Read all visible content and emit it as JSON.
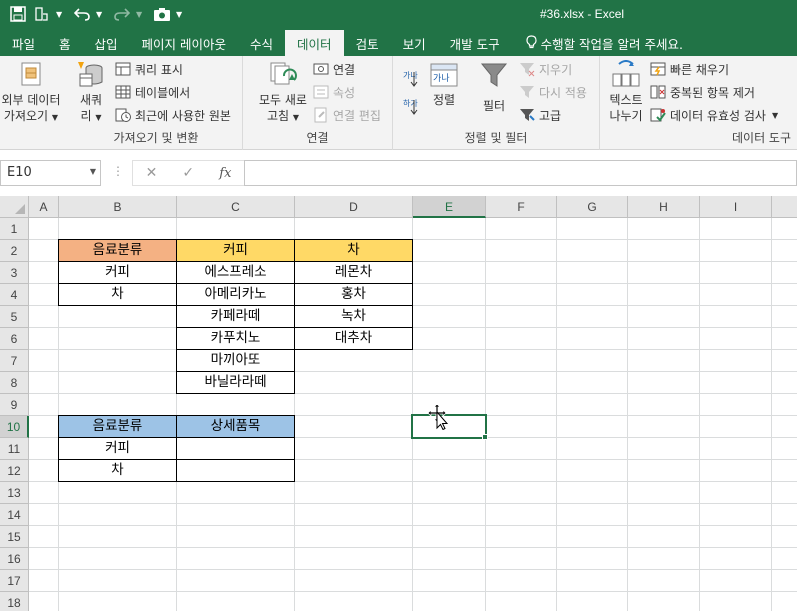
{
  "title": "#36.xlsx - Excel",
  "qat": {
    "save_icon": "save-icon",
    "undo_icon": "undo-icon",
    "redo_icon": "redo-icon",
    "camera_icon": "camera-icon"
  },
  "tabs": [
    {
      "label": "파일"
    },
    {
      "label": "홈"
    },
    {
      "label": "삽입"
    },
    {
      "label": "페이지 레이아웃"
    },
    {
      "label": "수식"
    },
    {
      "label": "데이터",
      "active": true
    },
    {
      "label": "검토"
    },
    {
      "label": "보기"
    },
    {
      "label": "개발 도구"
    },
    {
      "label": "수행할 작업을 알려 주세요."
    }
  ],
  "ribbon": {
    "get_transform": {
      "external_line1": "외부 데이터",
      "external_line2": "가져오기",
      "new_query_line1": "새쿼",
      "new_query_line2": "리",
      "show_queries": "쿼리 표시",
      "from_table": "테이블에서",
      "recent_sources": "최근에 사용한 원본",
      "label": "가져오기 및 변환"
    },
    "connections": {
      "refresh_line1": "모두 새로",
      "refresh_line2": "고침",
      "connections": "연결",
      "properties": "속성",
      "edit_links": "연결 편집",
      "label": "연결"
    },
    "sort_filter": {
      "sort": "정렬",
      "filter": "필터",
      "clear": "지우기",
      "reapply": "다시 적용",
      "advanced": "고급",
      "label": "정렬 및 필터",
      "sort_icon_text": "가나",
      "sort_icon_text2": "하가"
    },
    "data_tools": {
      "text_to_columns_line1": "텍스트",
      "text_to_columns_line2": "나누기",
      "flash_fill": "빠른 채우기",
      "remove_duplicates": "중복된 항목 제거",
      "data_validation": "데이터 유효성 검사",
      "label": "데이터 도구"
    }
  },
  "formula_bar": {
    "name_box": "E10",
    "cancel": "✕",
    "enter": "✓",
    "fx": "fx",
    "value": ""
  },
  "columns": [
    "A",
    "B",
    "C",
    "D",
    "E",
    "F",
    "G",
    "H",
    "I"
  ],
  "rows": [
    "1",
    "2",
    "3",
    "4",
    "5",
    "6",
    "7",
    "8",
    "9",
    "10",
    "11",
    "12",
    "13",
    "14",
    "15",
    "16",
    "17",
    "18"
  ],
  "selected_column": "E",
  "selected_row": "10",
  "table1": {
    "headers": [
      "음료분류",
      "커피",
      "차"
    ],
    "col_b": [
      "커피",
      "차"
    ],
    "col_c": [
      "에스프레소",
      "아메리카노",
      "카페라떼",
      "카푸치노",
      "마끼아또",
      "바닐라라떼"
    ],
    "col_d": [
      "레몬차",
      "홍차",
      "녹차",
      "대추차"
    ]
  },
  "table2": {
    "headers": [
      "음료분류",
      "상세품목"
    ],
    "col_b": [
      "커피",
      "차"
    ],
    "col_c": [
      "",
      ""
    ]
  },
  "colors": {
    "excel_green": "#217346",
    "header_orange": "#f4b183",
    "header_yellow": "#ffd966",
    "header_blue": "#9dc3e6"
  }
}
